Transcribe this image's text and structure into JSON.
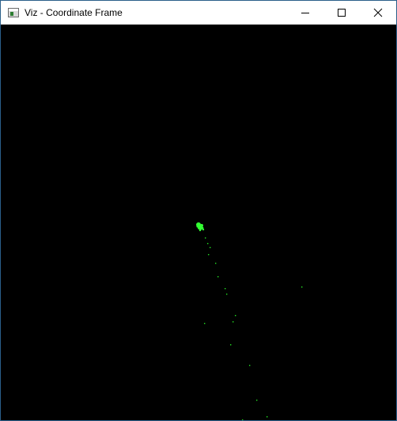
{
  "window": {
    "title": "Viz - Coordinate Frame",
    "icon": "window-app-icon",
    "controls": [
      {
        "name": "minimize-button",
        "icon": "minimize-icon"
      },
      {
        "name": "maximize-button",
        "icon": "maximize-icon"
      },
      {
        "name": "close-button",
        "icon": "close-icon"
      }
    ]
  },
  "viewport": {
    "background_color": "#000000",
    "point_color": "#22e022",
    "highlight_color": "#33ff33"
  }
}
